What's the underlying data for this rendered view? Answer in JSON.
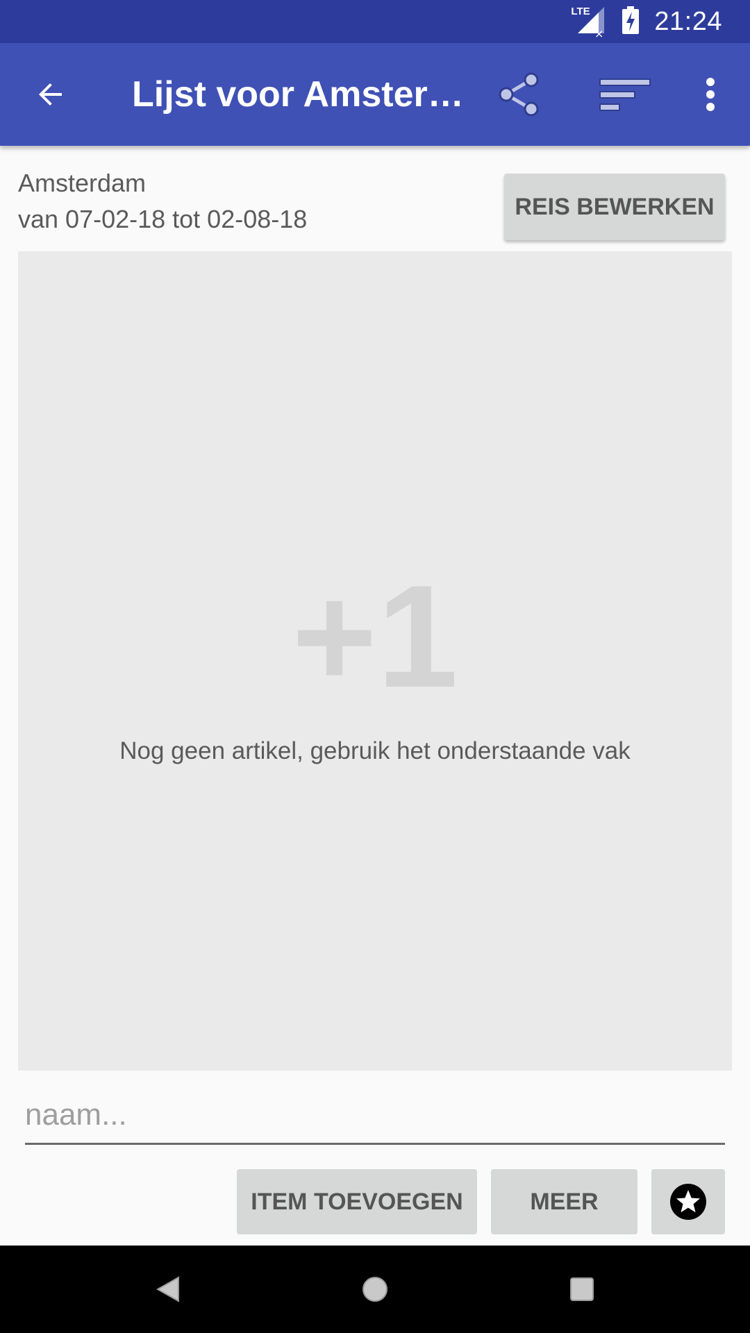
{
  "status_bar": {
    "network": "LTE",
    "time": "21:24",
    "bg_color": "#2d3c9c"
  },
  "app_bar": {
    "title": "Lijst voor Amster…",
    "bg_color": "#3f51b5",
    "icons": [
      "back-arrow-icon",
      "share-icon",
      "sort-icon",
      "more-vert-icon"
    ]
  },
  "trip": {
    "city": "Amsterdam",
    "dates": "van 07-02-18 tot 02-08-18",
    "edit_label": "REIS BEWERKEN"
  },
  "empty_state": {
    "counter": "+1",
    "message": "Nog geen artikel, gebruik het onderstaande vak"
  },
  "input": {
    "placeholder": "naam...",
    "value": ""
  },
  "actions": {
    "add_item_label": "ITEM TOEVOEGEN",
    "more_label": "MEER",
    "favorite_icon": "star-icon"
  },
  "nav": {
    "icons": [
      "back-nav-icon",
      "home-nav-icon",
      "recents-nav-icon"
    ]
  }
}
